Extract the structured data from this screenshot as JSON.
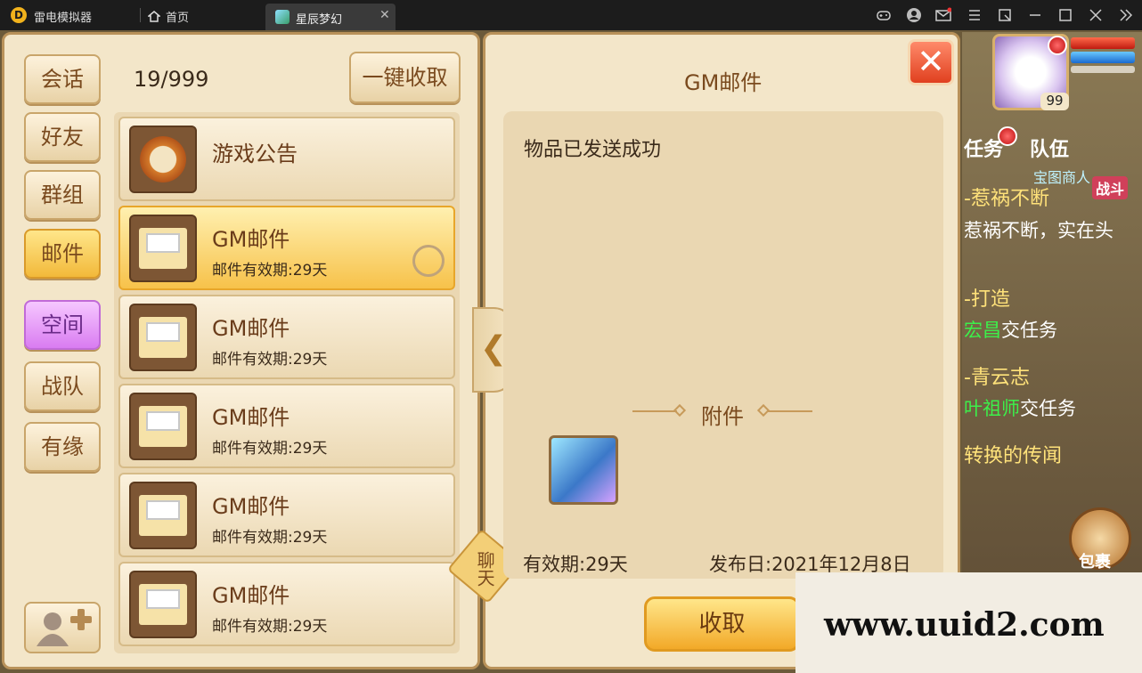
{
  "titlebar": {
    "app_name": "雷电模拟器",
    "home_label": "首页",
    "tab_label": "星辰梦幻",
    "tab_close": "✕"
  },
  "sidebar": {
    "items": [
      {
        "label": "会话"
      },
      {
        "label": "好友"
      },
      {
        "label": "群组"
      },
      {
        "label": "邮件"
      },
      {
        "label": "空间"
      },
      {
        "label": "战队"
      },
      {
        "label": "有缘"
      }
    ]
  },
  "mail_list": {
    "count": "19/999",
    "collect_all_label": "一键收取",
    "items": [
      {
        "title": "游戏公告",
        "subtitle": ""
      },
      {
        "title": "GM邮件",
        "subtitle": "邮件有效期:29天"
      },
      {
        "title": "GM邮件",
        "subtitle": "邮件有效期:29天"
      },
      {
        "title": "GM邮件",
        "subtitle": "邮件有效期:29天"
      },
      {
        "title": "GM邮件",
        "subtitle": "邮件有效期:29天"
      },
      {
        "title": "GM邮件",
        "subtitle": "邮件有效期:29天"
      }
    ]
  },
  "chat_tag": "聊天",
  "mail_detail": {
    "title": "GM邮件",
    "body": "物品已发送成功",
    "attachment_label": "附件",
    "validity": "有效期:29天",
    "publish_date": "发布日:2021年12月8日",
    "collect_label": "收取"
  },
  "hud": {
    "level": "99",
    "quest_tab": "任务",
    "team_tab": "队伍",
    "team_name": "宝图商人",
    "battle_tag": "战斗",
    "quests": [
      {
        "title": "-惹祸不断",
        "desc": "惹祸不断，实在头"
      },
      {
        "title": "-打造",
        "desc_npc": "宏昌",
        "desc_rest": "交任务"
      },
      {
        "title": "-青云志",
        "desc_npc": "叶祖师",
        "desc_rest": "交任务"
      },
      {
        "title": "转换的传闻",
        "desc": ""
      }
    ],
    "bag_label": "包裹"
  },
  "watermark": "www.uuid2.com",
  "colors": {
    "panel_bg": "#f3e6c9",
    "panel_border": "#b9925a",
    "selected_item": "#f7c24a",
    "space_button": "#d97cf1",
    "close_button": "#e0401f"
  }
}
